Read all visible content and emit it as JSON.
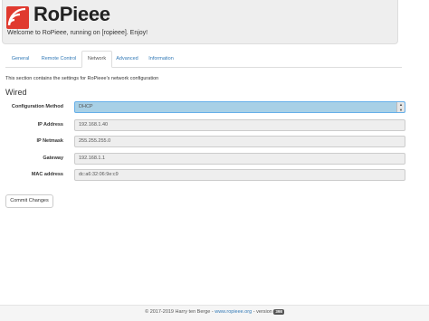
{
  "header": {
    "brand": "RoPieee",
    "tagline": "Welcome to RoPieee, running on [ropieee]. Enjoy!",
    "logo_icon": "raspberry-logo-icon",
    "accent": "#e03a2f"
  },
  "tabs": [
    {
      "label": "General",
      "active": false
    },
    {
      "label": "Remote Control",
      "active": false
    },
    {
      "label": "Network",
      "active": true
    },
    {
      "label": "Advanced",
      "active": false
    },
    {
      "label": "Information",
      "active": false
    }
  ],
  "network": {
    "description": "This section contains the settings for RoPieee's network configuration",
    "section_title": "Wired",
    "fields": [
      {
        "label": "Configuration Method",
        "value": "DHCP",
        "type": "select"
      },
      {
        "label": "IP Address",
        "value": "192.168.1.40",
        "type": "text"
      },
      {
        "label": "IP Netmask",
        "value": "255.255.255.0",
        "type": "text"
      },
      {
        "label": "Gateway",
        "value": "192.168.1.1",
        "type": "text"
      },
      {
        "label": "MAC address",
        "value": "dc:a6:32:06:9e:c9",
        "type": "text"
      }
    ],
    "commit_label": "Commit Changes"
  },
  "footer": {
    "copyright": "© 2017-2019 Harry ten Berge - ",
    "link": "www.ropieee.org",
    "version_prefix": " - version ",
    "version_badge": "398"
  }
}
